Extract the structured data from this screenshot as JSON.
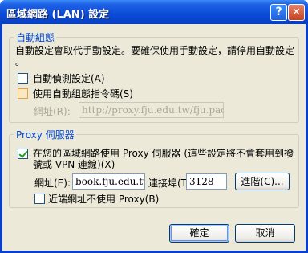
{
  "window": {
    "title": "區域網路 (LAN) 設定",
    "help_glyph": "?",
    "close_glyph": "✕"
  },
  "auto_config": {
    "group_label": "自動組態",
    "description_line1": "自動設定會取代手動設定。要確保使用手動設定，請停用自動設定",
    "description_line2": "。",
    "auto_detect": {
      "label": "自動偵測設定(A)",
      "checked": false
    },
    "use_script": {
      "label": "使用自動組態指令碼(S)",
      "checked": false
    },
    "address_label": "網址(R):",
    "address_value": "http://proxy.fju.edu.tw/fju.pac"
  },
  "proxy": {
    "group_label": "Proxy 伺服器",
    "use_proxy": {
      "label_line1": "在您的區域網路使用 Proxy 伺服器 (這些設定將不會套用到撥",
      "label_line2": "號或 VPN 連線)(X)",
      "checked": true
    },
    "address_label": "網址(E):",
    "address_value": "book.fju.edu.tw",
    "port_label": "連接埠(T):",
    "port_value": "3128",
    "advanced_button": "進階(C)...",
    "bypass_local": {
      "label": "近端網址不使用 Proxy(B)",
      "checked": false
    }
  },
  "buttons": {
    "ok": "確定",
    "cancel": "取消"
  }
}
